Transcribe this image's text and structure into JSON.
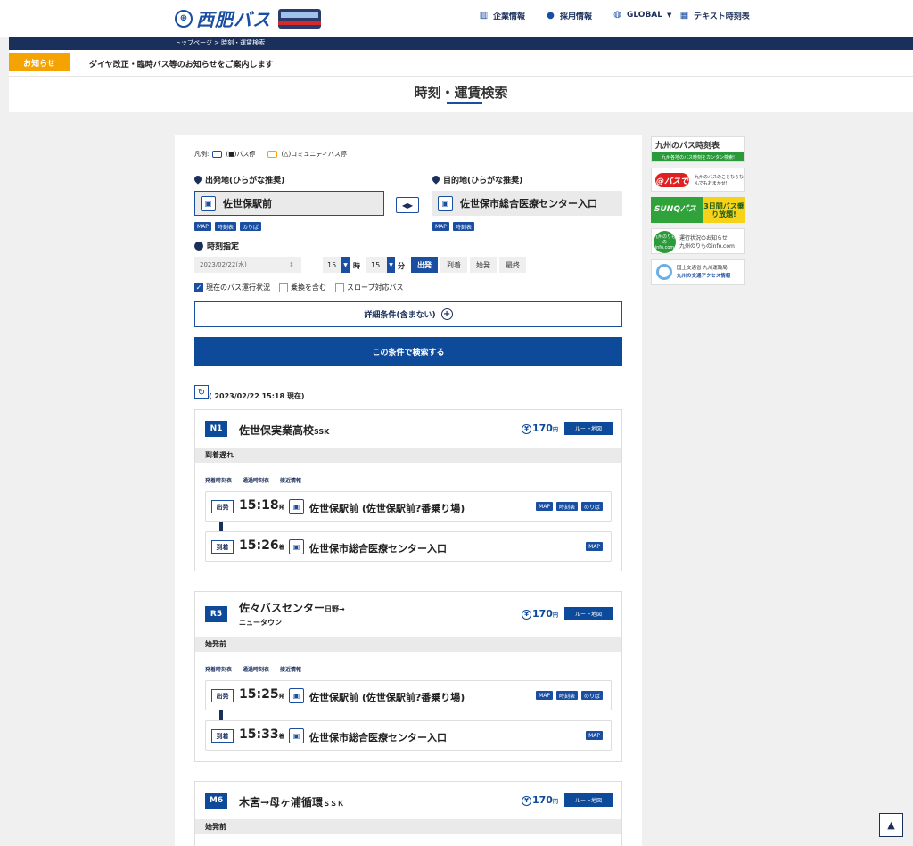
{
  "header": {
    "logo_text": "西肥バス",
    "nav": [
      {
        "label": "企業情報",
        "icon": "building-icon"
      },
      {
        "label": "採用情報",
        "icon": "person-icon"
      },
      {
        "label": "GLOBAL",
        "icon": "globe-icon"
      },
      {
        "label": "テキスト時刻表",
        "icon": "timetable-icon"
      }
    ]
  },
  "breadcrumb": "トップページ > 時刻・運賃検索",
  "notice": {
    "badge": "お知らせ",
    "text": "ダイヤ改正・臨時バス等のお知らせをご案内します"
  },
  "page_title": "時刻・運賃検索",
  "legend": {
    "prefix": "凡例:",
    "bus_stop": "(■)バス停",
    "community_stop": "(△)コミュニティバス停"
  },
  "origin": {
    "label": "出発地(ひらがな推奨)",
    "value": "佐世保駅前"
  },
  "destination": {
    "label": "目的地(ひらがな推奨)",
    "value": "佐世保市総合医療センター入口"
  },
  "stop_tags": {
    "map": "MAP",
    "timetable": "時刻表",
    "platform": "のりば"
  },
  "time_spec": {
    "label": "時刻指定",
    "date": "2023/02/22(水)",
    "hour": "15",
    "hour_unit": "時",
    "minute": "15",
    "minute_unit": "分",
    "modes": [
      "出発",
      "到着",
      "始発",
      "最終"
    ]
  },
  "options": [
    {
      "label": "現在のバス運行状況",
      "checked": true
    },
    {
      "label": "乗換を含む",
      "checked": false
    },
    {
      "label": "スロープ対応バス",
      "checked": false
    }
  ],
  "detail_button": "詳細条件(含まない)",
  "search_button": "この条件で検索する",
  "as_of": "( 2023/02/22 15:18 現在)",
  "card_labels": {
    "route_map": "ルート地図",
    "yen_unit": "円",
    "dep_label": "出発",
    "arr_label": "到着",
    "dep_suffix": "発",
    "arr_suffix": "着"
  },
  "result_links": [
    "発着時刻表",
    "通過時刻表",
    "接近情報"
  ],
  "results": [
    {
      "route": "N1",
      "name": "佐世保実業高校",
      "name_suffix": "SSK",
      "name_line2": "",
      "fare": "170",
      "status": "到着遅れ",
      "dep_time": "15:18",
      "dep_stop": "佐世保駅前 (佐世保駅前?番乗り場)",
      "arr_time": "15:26",
      "arr_stop": "佐世保市総合医療センター入口"
    },
    {
      "route": "R5",
      "name": "佐々バスセンター",
      "name_suffix": "日野→",
      "name_line2": "ニュータウン",
      "fare": "170",
      "status": "始発前",
      "dep_time": "15:25",
      "dep_stop": "佐世保駅前 (佐世保駅前?番乗り場)",
      "arr_time": "15:33",
      "arr_stop": "佐世保市総合医療センター入口"
    },
    {
      "route": "M6",
      "name": "木宮→母ヶ浦循環",
      "name_suffix": "ＳＳＫ",
      "name_line2": "",
      "fare": "170",
      "status": "始発前"
    }
  ],
  "sidebar": {
    "b1_title": "九州のバス時刻表",
    "b1_sub": "九州各地のバス時刻をカンタン検索!",
    "b2_logo": "@バスで",
    "b2_text": "九州のバスのことならなんでもおまかせ!",
    "b3_left": "SUNQパス",
    "b3_right": "3日間バス乗り放題!",
    "b4_logo": "九州のりものinfo.com",
    "b4_line1": "運行状況のお知らせ",
    "b4_line2": "九州のりものinfo.com",
    "b5_line1": "国土交通省 九州運輸局",
    "b5_line2": "九州の交通アクセス情報"
  }
}
